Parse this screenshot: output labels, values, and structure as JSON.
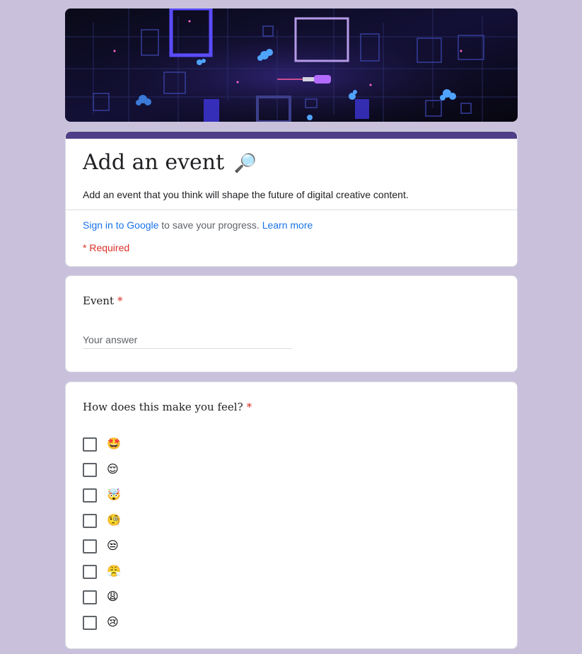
{
  "theme": {
    "background": "#c9c1dc",
    "accent": "#503e88",
    "link": "#1a73e8",
    "required": "#d93025"
  },
  "header": {
    "banner_icon": "abstract-digital-circuit-banner",
    "title": "Add an event",
    "title_icon": "🔎",
    "description": "Add an event that you think will shape the future of digital creative content.",
    "signin_link": "Sign in to Google",
    "signin_text": " to save your progress. ",
    "learn_more": "Learn more",
    "required_note": "* Required"
  },
  "questions": {
    "event": {
      "title": "Event",
      "required_mark": "*",
      "placeholder": "Your answer",
      "value": ""
    },
    "feeling": {
      "title": "How does this make you feel?",
      "required_mark": "*",
      "options": [
        {
          "label": "🤩",
          "checked": false
        },
        {
          "label": "😌",
          "checked": false
        },
        {
          "label": "🤯",
          "checked": false
        },
        {
          "label": "🧐",
          "checked": false
        },
        {
          "label": "😒",
          "checked": false
        },
        {
          "label": "😤",
          "checked": false
        },
        {
          "label": "😩",
          "checked": false
        },
        {
          "label": "😢",
          "checked": false
        }
      ]
    }
  }
}
